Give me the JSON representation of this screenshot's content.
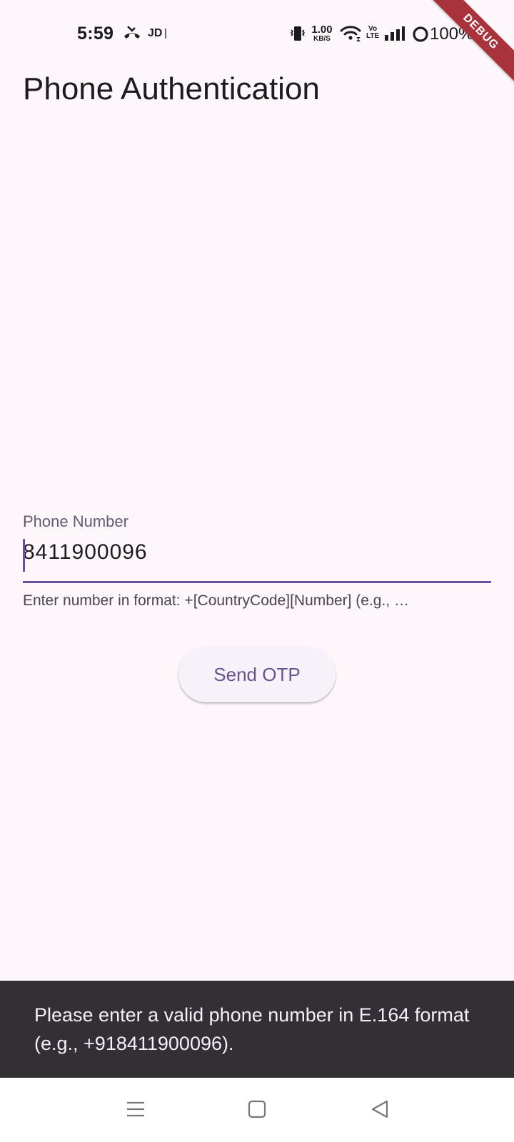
{
  "status_bar": {
    "time": "5:59",
    "carrier": "JD",
    "net_speed_value": "1.00",
    "net_speed_unit": "KB/S",
    "volte_top": "Vo",
    "volte_bottom": "LTE",
    "battery": "100%",
    "icons": [
      "missed-call-icon",
      "vibrate-icon",
      "wifi-icon",
      "signal-icon",
      "battery-ring-icon"
    ]
  },
  "debug_banner": "DEBUG",
  "app_bar": {
    "title": "Phone Authentication"
  },
  "phone_field": {
    "label": "Phone Number",
    "value": "8411900096",
    "helper": "Enter number in format: +[CountryCode][Number] (e.g., …"
  },
  "send_button": {
    "label": "Send OTP"
  },
  "snackbar": {
    "message": "Please enter a valid phone number in E.164 format (e.g., +918411900096)."
  },
  "nav_bar": {
    "icons": [
      "menu-icon",
      "home-icon",
      "back-icon"
    ]
  },
  "colors": {
    "background": "#fdf7fc",
    "primary": "#6750a4",
    "button_text": "#65558f",
    "snackbar_bg": "#322f35",
    "debug_banner": "#a8333a"
  }
}
